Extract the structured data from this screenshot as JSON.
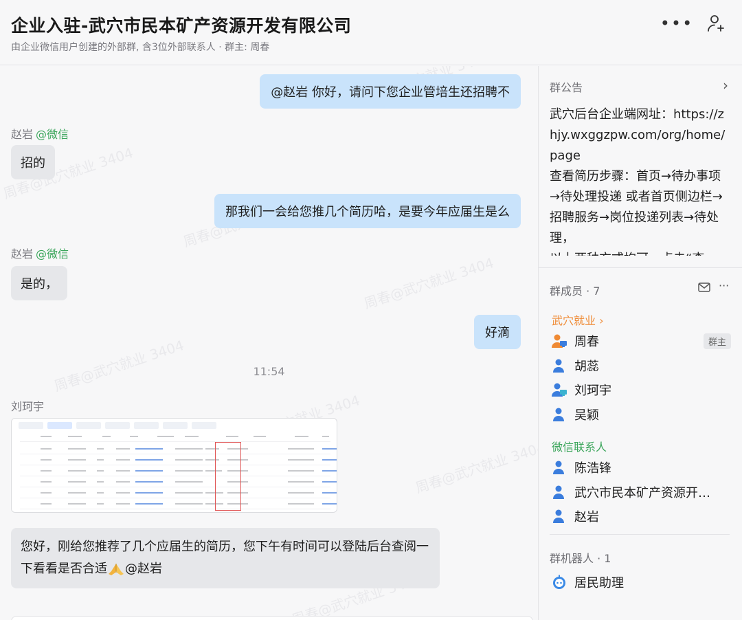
{
  "header": {
    "title": "企业入驻-武穴市民本矿产资源开发有限公司",
    "subtitle": "由企业微信用户创建的外部群, 含3位外部联系人 · 群主: 周春",
    "more_icon": "more-horizontal-icon",
    "add_member_icon": "add-person-icon"
  },
  "chat": {
    "watermark": "周春@武穴就业 3404",
    "messages": [
      {
        "dir": "out",
        "text": "@赵岩 你好，请问下您企业管培生还招聘不"
      },
      {
        "dir": "in",
        "sender": "赵岩",
        "sender_tag": "@微信",
        "text": "招的"
      },
      {
        "dir": "out",
        "text": "那我们一会给您推几个简历哈，是要今年应届生是么"
      },
      {
        "dir": "in",
        "sender": "赵岩",
        "sender_tag": "@微信",
        "text": "是的，"
      },
      {
        "dir": "out",
        "text": "好滴"
      },
      {
        "dir": "in",
        "sender": "刘珂宇",
        "text": "您好，刚给您推荐了几个应届生的简历，您下午有时间可以登陆后台查阅一下看看是否合适",
        "mention": "@赵岩",
        "emoji_icon": "folded-hands-emoji-icon"
      }
    ],
    "time": "11:54",
    "image_attachment_icon": "screenshot-thumbnail"
  },
  "panel": {
    "notice": {
      "title": "群公告",
      "text": "武穴后台企业端网址：https://zhjy.wxggzpw.com/org/home/page\n查看简历步骤：首页→待办事项→待处理投递 或者首页侧边栏→招聘服务→岗位投递列表→待处理，\n以上两种方式均可，点击“查"
    },
    "members": {
      "title": "群成员 · 7",
      "group_org": "武穴就业",
      "group_wechat": "微信联系人",
      "owner_badge": "群主",
      "org_members": [
        "周春",
        "胡蕊",
        "刘珂宇",
        "吴颖"
      ],
      "wechat_members": [
        "陈浩锋",
        "武穴市民本矿产资源开发...",
        "赵岩"
      ]
    },
    "robots": {
      "title": "群机器人 · 1",
      "items": [
        "居民助理"
      ]
    },
    "colors": {
      "accent_orange": "#ef8a34",
      "wechat_green": "#3aa55a",
      "bubble_out": "#c9e3fb",
      "bubble_in": "#e6e7ea",
      "member_icon": "#3b7ddd"
    }
  }
}
